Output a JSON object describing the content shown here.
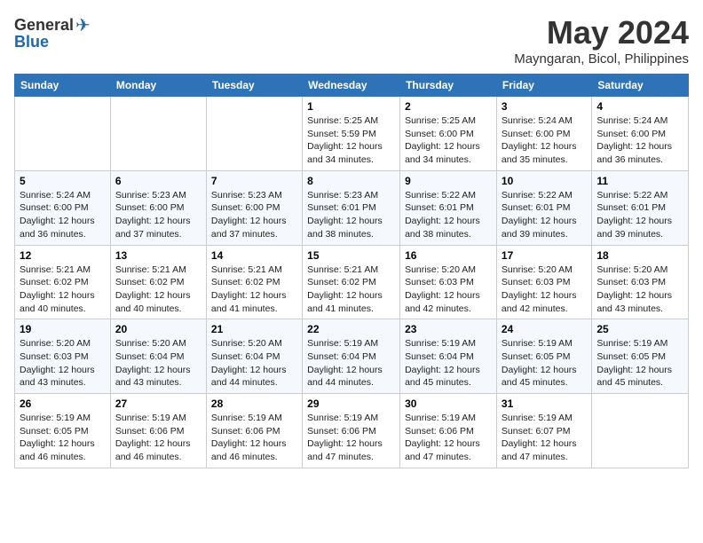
{
  "header": {
    "logo_general": "General",
    "logo_blue": "Blue",
    "month_title": "May 2024",
    "location": "Mayngaran, Bicol, Philippines"
  },
  "days_of_week": [
    "Sunday",
    "Monday",
    "Tuesday",
    "Wednesday",
    "Thursday",
    "Friday",
    "Saturday"
  ],
  "weeks": [
    [
      {
        "day": "",
        "info": ""
      },
      {
        "day": "",
        "info": ""
      },
      {
        "day": "",
        "info": ""
      },
      {
        "day": "1",
        "info": "Sunrise: 5:25 AM\nSunset: 5:59 PM\nDaylight: 12 hours\nand 34 minutes."
      },
      {
        "day": "2",
        "info": "Sunrise: 5:25 AM\nSunset: 6:00 PM\nDaylight: 12 hours\nand 34 minutes."
      },
      {
        "day": "3",
        "info": "Sunrise: 5:24 AM\nSunset: 6:00 PM\nDaylight: 12 hours\nand 35 minutes."
      },
      {
        "day": "4",
        "info": "Sunrise: 5:24 AM\nSunset: 6:00 PM\nDaylight: 12 hours\nand 36 minutes."
      }
    ],
    [
      {
        "day": "5",
        "info": "Sunrise: 5:24 AM\nSunset: 6:00 PM\nDaylight: 12 hours\nand 36 minutes."
      },
      {
        "day": "6",
        "info": "Sunrise: 5:23 AM\nSunset: 6:00 PM\nDaylight: 12 hours\nand 37 minutes."
      },
      {
        "day": "7",
        "info": "Sunrise: 5:23 AM\nSunset: 6:00 PM\nDaylight: 12 hours\nand 37 minutes."
      },
      {
        "day": "8",
        "info": "Sunrise: 5:23 AM\nSunset: 6:01 PM\nDaylight: 12 hours\nand 38 minutes."
      },
      {
        "day": "9",
        "info": "Sunrise: 5:22 AM\nSunset: 6:01 PM\nDaylight: 12 hours\nand 38 minutes."
      },
      {
        "day": "10",
        "info": "Sunrise: 5:22 AM\nSunset: 6:01 PM\nDaylight: 12 hours\nand 39 minutes."
      },
      {
        "day": "11",
        "info": "Sunrise: 5:22 AM\nSunset: 6:01 PM\nDaylight: 12 hours\nand 39 minutes."
      }
    ],
    [
      {
        "day": "12",
        "info": "Sunrise: 5:21 AM\nSunset: 6:02 PM\nDaylight: 12 hours\nand 40 minutes."
      },
      {
        "day": "13",
        "info": "Sunrise: 5:21 AM\nSunset: 6:02 PM\nDaylight: 12 hours\nand 40 minutes."
      },
      {
        "day": "14",
        "info": "Sunrise: 5:21 AM\nSunset: 6:02 PM\nDaylight: 12 hours\nand 41 minutes."
      },
      {
        "day": "15",
        "info": "Sunrise: 5:21 AM\nSunset: 6:02 PM\nDaylight: 12 hours\nand 41 minutes."
      },
      {
        "day": "16",
        "info": "Sunrise: 5:20 AM\nSunset: 6:03 PM\nDaylight: 12 hours\nand 42 minutes."
      },
      {
        "day": "17",
        "info": "Sunrise: 5:20 AM\nSunset: 6:03 PM\nDaylight: 12 hours\nand 42 minutes."
      },
      {
        "day": "18",
        "info": "Sunrise: 5:20 AM\nSunset: 6:03 PM\nDaylight: 12 hours\nand 43 minutes."
      }
    ],
    [
      {
        "day": "19",
        "info": "Sunrise: 5:20 AM\nSunset: 6:03 PM\nDaylight: 12 hours\nand 43 minutes."
      },
      {
        "day": "20",
        "info": "Sunrise: 5:20 AM\nSunset: 6:04 PM\nDaylight: 12 hours\nand 43 minutes."
      },
      {
        "day": "21",
        "info": "Sunrise: 5:20 AM\nSunset: 6:04 PM\nDaylight: 12 hours\nand 44 minutes."
      },
      {
        "day": "22",
        "info": "Sunrise: 5:19 AM\nSunset: 6:04 PM\nDaylight: 12 hours\nand 44 minutes."
      },
      {
        "day": "23",
        "info": "Sunrise: 5:19 AM\nSunset: 6:04 PM\nDaylight: 12 hours\nand 45 minutes."
      },
      {
        "day": "24",
        "info": "Sunrise: 5:19 AM\nSunset: 6:05 PM\nDaylight: 12 hours\nand 45 minutes."
      },
      {
        "day": "25",
        "info": "Sunrise: 5:19 AM\nSunset: 6:05 PM\nDaylight: 12 hours\nand 45 minutes."
      }
    ],
    [
      {
        "day": "26",
        "info": "Sunrise: 5:19 AM\nSunset: 6:05 PM\nDaylight: 12 hours\nand 46 minutes."
      },
      {
        "day": "27",
        "info": "Sunrise: 5:19 AM\nSunset: 6:06 PM\nDaylight: 12 hours\nand 46 minutes."
      },
      {
        "day": "28",
        "info": "Sunrise: 5:19 AM\nSunset: 6:06 PM\nDaylight: 12 hours\nand 46 minutes."
      },
      {
        "day": "29",
        "info": "Sunrise: 5:19 AM\nSunset: 6:06 PM\nDaylight: 12 hours\nand 47 minutes."
      },
      {
        "day": "30",
        "info": "Sunrise: 5:19 AM\nSunset: 6:06 PM\nDaylight: 12 hours\nand 47 minutes."
      },
      {
        "day": "31",
        "info": "Sunrise: 5:19 AM\nSunset: 6:07 PM\nDaylight: 12 hours\nand 47 minutes."
      },
      {
        "day": "",
        "info": ""
      }
    ]
  ]
}
